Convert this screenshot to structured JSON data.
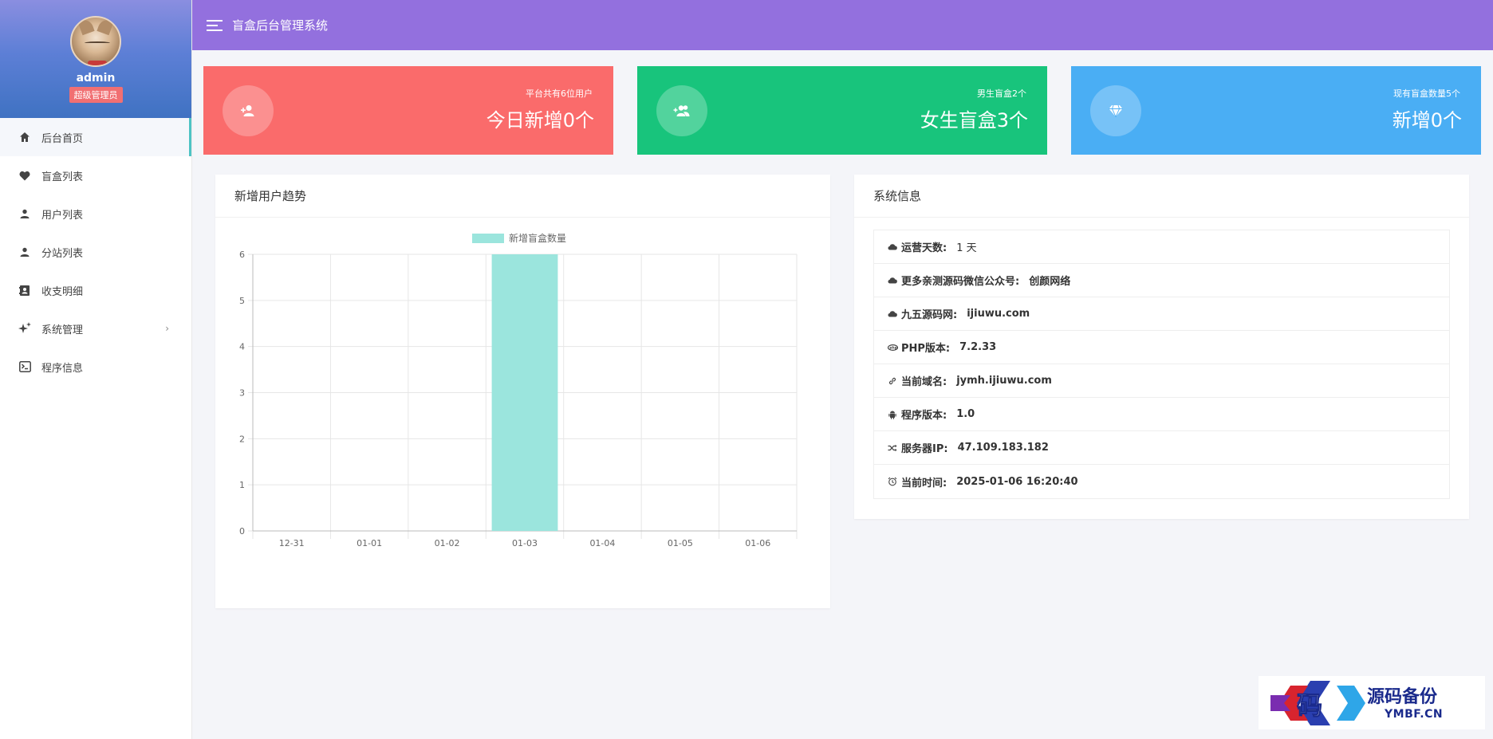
{
  "app": {
    "title": "盲盒后台管理系统"
  },
  "user": {
    "name": "admin",
    "role": "超级管理员"
  },
  "sidebar": {
    "items": [
      {
        "label": "后台首页",
        "icon": "home-icon",
        "active": true
      },
      {
        "label": "盲盒列表",
        "icon": "heart-icon"
      },
      {
        "label": "用户列表",
        "icon": "user-icon"
      },
      {
        "label": "分站列表",
        "icon": "user-icon"
      },
      {
        "label": "收支明细",
        "icon": "contact-book-icon"
      },
      {
        "label": "系统管理",
        "icon": "sparkles-icon",
        "has_children": true,
        "chevron": "›"
      },
      {
        "label": "程序信息",
        "icon": "terminal-icon"
      }
    ]
  },
  "stats": [
    {
      "sub": "平台共有6位用户",
      "main": "今日新增0个",
      "color": "#fa6b6b",
      "icon": "user-plus-icon"
    },
    {
      "sub": "男生盲盒2个",
      "main": "女生盲盒3个",
      "color": "#18c47c",
      "icon": "users-plus-icon"
    },
    {
      "sub": "现有盲盒数量5个",
      "main": "新增0个",
      "color": "#4aaef4",
      "icon": "diamond-icon"
    }
  ],
  "chart_panel": {
    "title": "新增用户趋势"
  },
  "chart_data": {
    "type": "bar",
    "categories": [
      "12-31",
      "01-01",
      "01-02",
      "01-03",
      "01-04",
      "01-05",
      "01-06"
    ],
    "series": [
      {
        "name": "新增盲盒数量",
        "values": [
          0,
          0,
          0,
          6,
          0,
          0,
          0
        ],
        "color": "#9be5dd"
      }
    ],
    "ylim": [
      0,
      6
    ],
    "yticks": [
      "0",
      "1",
      "2",
      "3",
      "4",
      "5",
      "6"
    ],
    "grid": true,
    "legend": "top-center"
  },
  "info_panel": {
    "title": "系统信息",
    "rows": [
      {
        "icon": "cloud-icon",
        "label": "运营天数:",
        "value": "1 天",
        "bold": false
      },
      {
        "icon": "cloud-icon",
        "label": "更多亲测源码微信公众号:",
        "value": "创颜网络",
        "bold": true
      },
      {
        "icon": "cloud-icon",
        "label": "九五源码网:",
        "value": "ijiuwu.com",
        "bold": true
      },
      {
        "icon": "php-icon",
        "label": "PHP版本:",
        "value": "7.2.33",
        "bold": true
      },
      {
        "icon": "link-icon",
        "label": "当前域名:",
        "value": "jymh.ijiuwu.com",
        "bold": true
      },
      {
        "icon": "android-icon",
        "label": "程序版本:",
        "value": "1.0",
        "bold": true
      },
      {
        "icon": "shuffle-icon",
        "label": "服务器IP:",
        "value": "47.109.183.182",
        "bold": true
      },
      {
        "icon": "alarm-clock-icon",
        "label": "当前时间:",
        "value": "2025-01-06 16:20:40",
        "bold": true
      }
    ]
  },
  "watermark": {
    "glyph": "码",
    "cn": "源码备份",
    "en": "YMBF.CN"
  }
}
